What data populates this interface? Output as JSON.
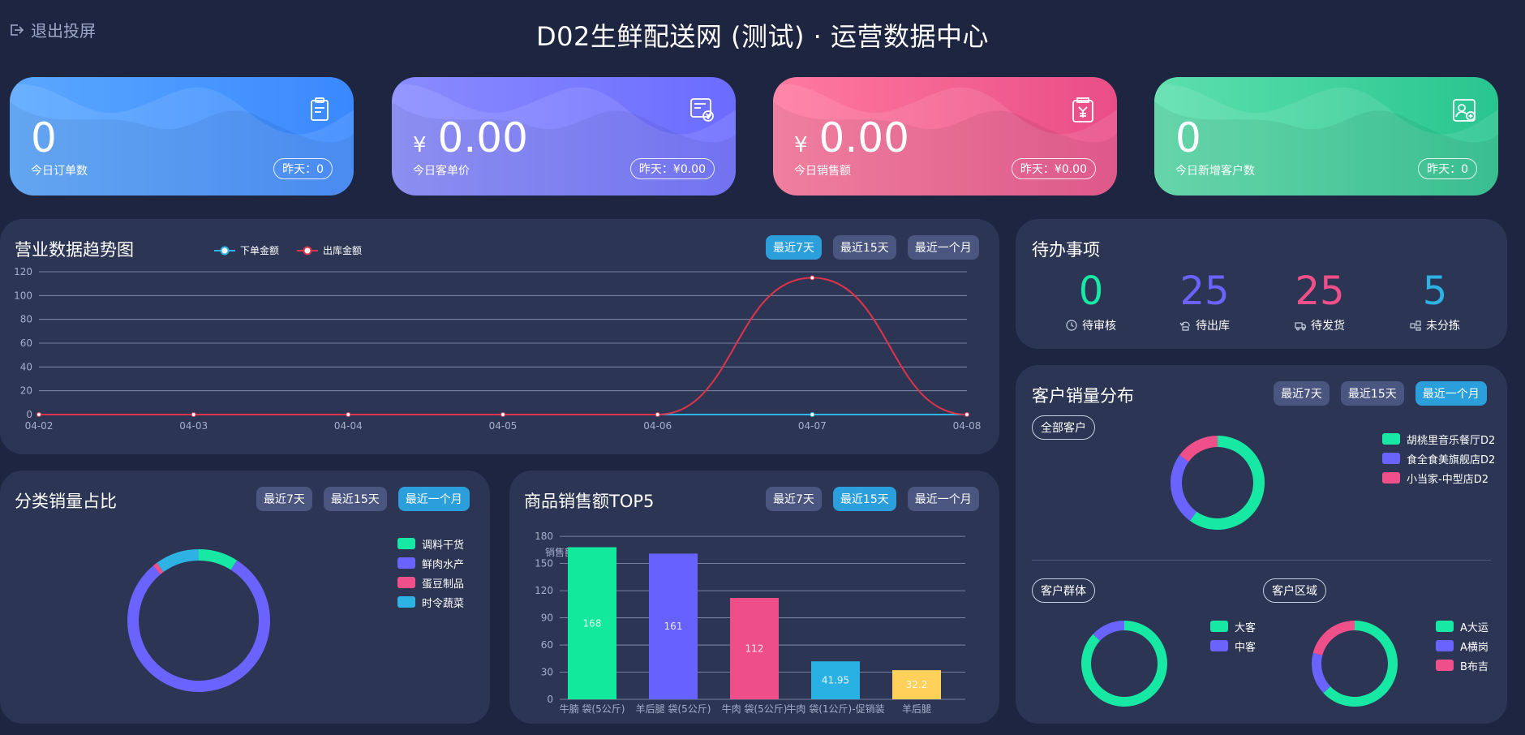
{
  "header": {
    "exit_label": "退出投屏",
    "title": "D02生鲜配送网 (测试) · 运营数据中心"
  },
  "stats": [
    {
      "value": "0",
      "currency": "",
      "label": "今日订单数",
      "yesterday": "昨天：0",
      "color_a": "#5aa8ff",
      "color_b": "#3a88ff",
      "icon": "clipboard-icon"
    },
    {
      "value": "0.00",
      "currency": "¥",
      "label": "今日客单价",
      "yesterday": "昨天：¥0.00",
      "color_a": "#8a8cff",
      "color_b": "#6b6cff",
      "icon": "invoice-yen-icon"
    },
    {
      "value": "0.00",
      "currency": "¥",
      "label": "今日销售额",
      "yesterday": "昨天：¥0.00",
      "color_a": "#ff7aa0",
      "color_b": "#e94d86",
      "icon": "bag-yen-icon"
    },
    {
      "value": "0",
      "currency": "",
      "label": "今日新增客户数",
      "yesterday": "昨天：0",
      "color_a": "#5de0ad",
      "color_b": "#28c590",
      "icon": "user-add-icon"
    }
  ],
  "trend": {
    "title": "营业数据趋势图",
    "legend": [
      "下单金额",
      "出库金额"
    ],
    "ranges": [
      "最近7天",
      "最近15天",
      "最近一个月"
    ],
    "active_range": 0
  },
  "chart_data": [
    {
      "type": "line",
      "x": [
        "04-02",
        "04-03",
        "04-04",
        "04-05",
        "04-06",
        "04-07",
        "04-08"
      ],
      "series": [
        {
          "name": "下单金额",
          "values": [
            0,
            0,
            0,
            0,
            0,
            0,
            0
          ],
          "color": "#2fb4e9"
        },
        {
          "name": "出库金额",
          "values": [
            0,
            0,
            0,
            0,
            0,
            115,
            0
          ],
          "color": "#e0334b"
        }
      ],
      "yticks": [
        0,
        20,
        40,
        60,
        80,
        100,
        120
      ],
      "ylim": [
        0,
        120
      ]
    },
    {
      "type": "pie",
      "labels": [
        "调料干货",
        "鲜肉水产",
        "蛋豆制品",
        "时令蔬菜"
      ],
      "values": [
        9,
        80,
        1,
        10
      ],
      "colors": [
        "#17e8a3",
        "#6a63ff",
        "#f0508a",
        "#2eb2e4"
      ]
    },
    {
      "type": "bar",
      "ylabel": "销售额",
      "categories": [
        "牛腩 袋(5公斤)",
        "羊后腿 袋(5公斤)",
        "牛肉 袋(5公斤)",
        "牛肉 袋(1公斤)-促销装",
        "羊后腿"
      ],
      "values": [
        168,
        161,
        112,
        41.95,
        32.2
      ],
      "colors": [
        "#12e99d",
        "#6762ff",
        "#ee4f88",
        "#2ab1e3",
        "#ffd15a"
      ],
      "yticks": [
        0,
        30,
        60,
        90,
        120,
        150,
        180
      ],
      "ylim": [
        0,
        190
      ]
    },
    {
      "type": "pie",
      "labels": [
        "胡桃里音乐餐厅D2",
        "食全食美旗舰店D2",
        "小当家-中型店D2"
      ],
      "values": [
        60,
        25,
        15
      ],
      "colors": [
        "#17e8a3",
        "#6a63ff",
        "#f0508a"
      ]
    },
    {
      "type": "pie",
      "labels": [
        "大客",
        "中客"
      ],
      "values": [
        87,
        13
      ],
      "colors": [
        "#17e8a3",
        "#6a63ff"
      ]
    },
    {
      "type": "pie",
      "labels": [
        "A大运",
        "A横岗",
        "B布吉"
      ],
      "values": [
        63,
        16,
        21
      ],
      "colors": [
        "#17e8a3",
        "#6a63ff",
        "#f0508a"
      ]
    }
  ],
  "todo": {
    "title": "待办事项",
    "items": [
      {
        "num": "0",
        "label": "待审核",
        "color": "#17e8a3",
        "icon": "clock-icon"
      },
      {
        "num": "25",
        "label": "待出库",
        "color": "#6a63ff",
        "icon": "return-icon"
      },
      {
        "num": "25",
        "label": "待发货",
        "color": "#f0508a",
        "icon": "truck-icon"
      },
      {
        "num": "5",
        "label": "未分拣",
        "color": "#2eb2e4",
        "icon": "sort-icon"
      }
    ]
  },
  "customer": {
    "title": "客户销量分布",
    "ranges": [
      "最近7天",
      "最近15天",
      "最近一个月"
    ],
    "active_range": 2,
    "all_label": "全部客户",
    "group_label": "客户群体",
    "area_label": "客户区域"
  },
  "category": {
    "title": "分类销量占比",
    "ranges": [
      "最近7天",
      "最近15天",
      "最近一个月"
    ],
    "active_range": 2
  },
  "top5": {
    "title": "商品销售额TOP5",
    "ranges": [
      "最近7天",
      "最近15天",
      "最近一个月"
    ],
    "active_range": 1
  }
}
